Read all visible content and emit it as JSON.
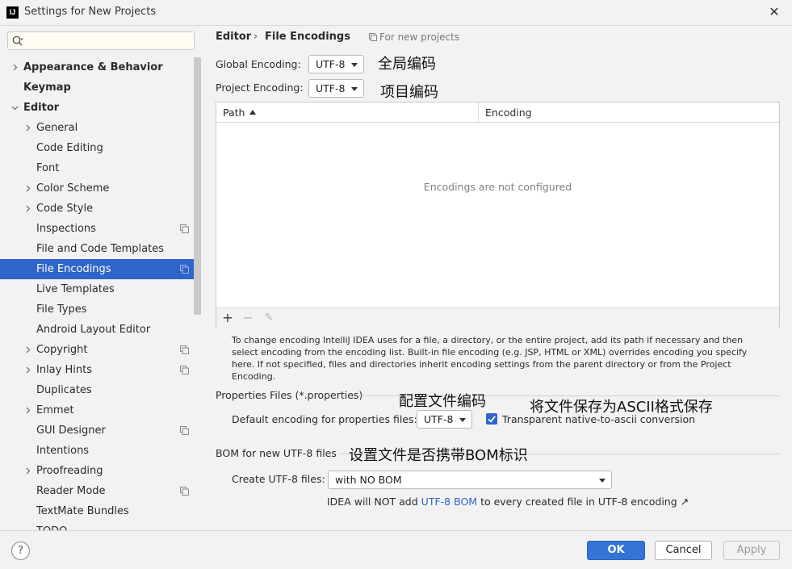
{
  "window": {
    "title": "Settings for New Projects",
    "close_glyph": "✕"
  },
  "search": {
    "placeholder": "",
    "value": ""
  },
  "sidebar": {
    "items": [
      {
        "label": "Appearance & Behavior",
        "bold": true,
        "chevron": "right",
        "indent": 0,
        "project_icon": false,
        "selected": false
      },
      {
        "label": "Keymap",
        "bold": true,
        "chevron": "none",
        "indent": 0,
        "project_icon": false,
        "selected": false
      },
      {
        "label": "Editor",
        "bold": true,
        "chevron": "down",
        "indent": 0,
        "project_icon": false,
        "selected": false
      },
      {
        "label": "General",
        "bold": false,
        "chevron": "right",
        "indent": 1,
        "project_icon": false,
        "selected": false
      },
      {
        "label": "Code Editing",
        "bold": false,
        "chevron": "none",
        "indent": 1,
        "project_icon": false,
        "selected": false
      },
      {
        "label": "Font",
        "bold": false,
        "chevron": "none",
        "indent": 1,
        "project_icon": false,
        "selected": false
      },
      {
        "label": "Color Scheme",
        "bold": false,
        "chevron": "right",
        "indent": 1,
        "project_icon": false,
        "selected": false
      },
      {
        "label": "Code Style",
        "bold": false,
        "chevron": "right",
        "indent": 1,
        "project_icon": false,
        "selected": false
      },
      {
        "label": "Inspections",
        "bold": false,
        "chevron": "none",
        "indent": 1,
        "project_icon": true,
        "selected": false
      },
      {
        "label": "File and Code Templates",
        "bold": false,
        "chevron": "none",
        "indent": 1,
        "project_icon": false,
        "selected": false
      },
      {
        "label": "File Encodings",
        "bold": false,
        "chevron": "none",
        "indent": 1,
        "project_icon": true,
        "selected": true
      },
      {
        "label": "Live Templates",
        "bold": false,
        "chevron": "none",
        "indent": 1,
        "project_icon": false,
        "selected": false
      },
      {
        "label": "File Types",
        "bold": false,
        "chevron": "none",
        "indent": 1,
        "project_icon": false,
        "selected": false
      },
      {
        "label": "Android Layout Editor",
        "bold": false,
        "chevron": "none",
        "indent": 1,
        "project_icon": false,
        "selected": false
      },
      {
        "label": "Copyright",
        "bold": false,
        "chevron": "right",
        "indent": 1,
        "project_icon": true,
        "selected": false
      },
      {
        "label": "Inlay Hints",
        "bold": false,
        "chevron": "right",
        "indent": 1,
        "project_icon": true,
        "selected": false
      },
      {
        "label": "Duplicates",
        "bold": false,
        "chevron": "none",
        "indent": 1,
        "project_icon": false,
        "selected": false
      },
      {
        "label": "Emmet",
        "bold": false,
        "chevron": "right",
        "indent": 1,
        "project_icon": false,
        "selected": false
      },
      {
        "label": "GUI Designer",
        "bold": false,
        "chevron": "none",
        "indent": 1,
        "project_icon": true,
        "selected": false
      },
      {
        "label": "Intentions",
        "bold": false,
        "chevron": "none",
        "indent": 1,
        "project_icon": false,
        "selected": false
      },
      {
        "label": "Proofreading",
        "bold": false,
        "chevron": "right",
        "indent": 1,
        "project_icon": false,
        "selected": false
      },
      {
        "label": "Reader Mode",
        "bold": false,
        "chevron": "none",
        "indent": 1,
        "project_icon": true,
        "selected": false
      },
      {
        "label": "TextMate Bundles",
        "bold": false,
        "chevron": "none",
        "indent": 1,
        "project_icon": false,
        "selected": false
      },
      {
        "label": "TODO",
        "bold": false,
        "chevron": "none",
        "indent": 1,
        "project_icon": false,
        "selected": false
      }
    ]
  },
  "breadcrumb": {
    "parent": "Editor",
    "separator": "›",
    "current": "File Encodings",
    "scope_note": "For new projects"
  },
  "global_encoding": {
    "label": "Global Encoding:",
    "value": "UTF-8",
    "annotation": "全局编码"
  },
  "project_encoding": {
    "label": "Project Encoding:",
    "value": "UTF-8",
    "annotation": "项目编码"
  },
  "table": {
    "columns": [
      "Path",
      "Encoding"
    ],
    "empty_text": "Encodings are not configured",
    "toolbar": {
      "add": "+",
      "remove": "−",
      "edit": "✎"
    }
  },
  "description": "To change encoding IntelliJ IDEA uses for a file, a directory, or the entire project, add its path if necessary and then select encoding from the encoding list. Built-in file encoding (e.g. JSP, HTML or XML) overrides encoding you specify here. If not specified, files and directories inherit encoding settings from the parent directory or from the Project Encoding.",
  "properties_section": {
    "title": "Properties Files (*.properties)",
    "annotation": "配置文件编码",
    "default_label": "Default encoding for properties files:",
    "default_value": "UTF-8",
    "transparent_checked": true,
    "transparent_label": "Transparent native-to-ascii conversion",
    "transparent_annotation": "将文件保存为ASCII格式保存"
  },
  "bom_section": {
    "title": "BOM for new UTF-8 files",
    "annotation": "设置文件是否携带BOM标识",
    "create_label": "Create UTF-8 files:",
    "create_value": "with NO BOM",
    "info_prefix": "IDEA will NOT add",
    "info_link": "UTF-8 BOM",
    "info_suffix": "to every created file in UTF-8 encoding ↗"
  },
  "footer": {
    "help": "?",
    "ok": "OK",
    "cancel": "Cancel",
    "apply": "Apply"
  },
  "colors": {
    "accent": "#2f65ca",
    "ok_button": "#3474d7",
    "background": "#f2f2f2"
  }
}
